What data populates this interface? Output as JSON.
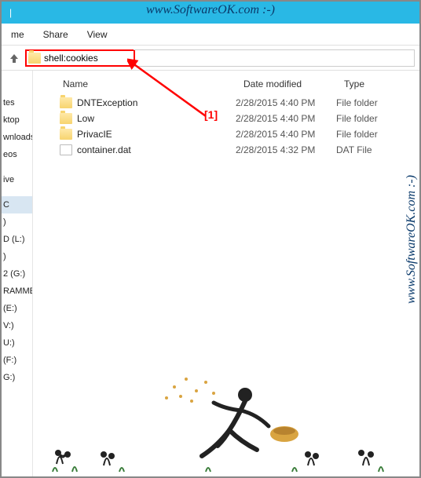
{
  "watermark": "www.SoftwareOK.com :-)",
  "ribbon": {
    "tab1": "me",
    "tab2": "Share",
    "tab3": "View"
  },
  "titlebar": {
    "sep": "|"
  },
  "address": {
    "value": "shell:cookies"
  },
  "annotation": {
    "label": "[1]"
  },
  "columns": {
    "name": "Name",
    "date": "Date modified",
    "type": "Type"
  },
  "files": [
    {
      "name": "DNTException",
      "date": "2/28/2015 4:40 PM",
      "type": "File folder",
      "kind": "folder"
    },
    {
      "name": "Low",
      "date": "2/28/2015 4:40 PM",
      "type": "File folder",
      "kind": "folder"
    },
    {
      "name": "PrivacIE",
      "date": "2/28/2015 4:40 PM",
      "type": "File folder",
      "kind": "folder"
    },
    {
      "name": "container.dat",
      "date": "2/28/2015 4:32 PM",
      "type": "DAT File",
      "kind": "file"
    }
  ],
  "sidebar": [
    "",
    "tes",
    "ktop",
    "wnloads",
    "eos",
    "",
    "ive",
    "",
    "C",
    ")",
    "D (L:)",
    ")",
    "2 (G:)",
    "RAMME (D:)",
    "(E:)",
    "V:)",
    "U:)",
    " (F:)",
    "G:)"
  ]
}
